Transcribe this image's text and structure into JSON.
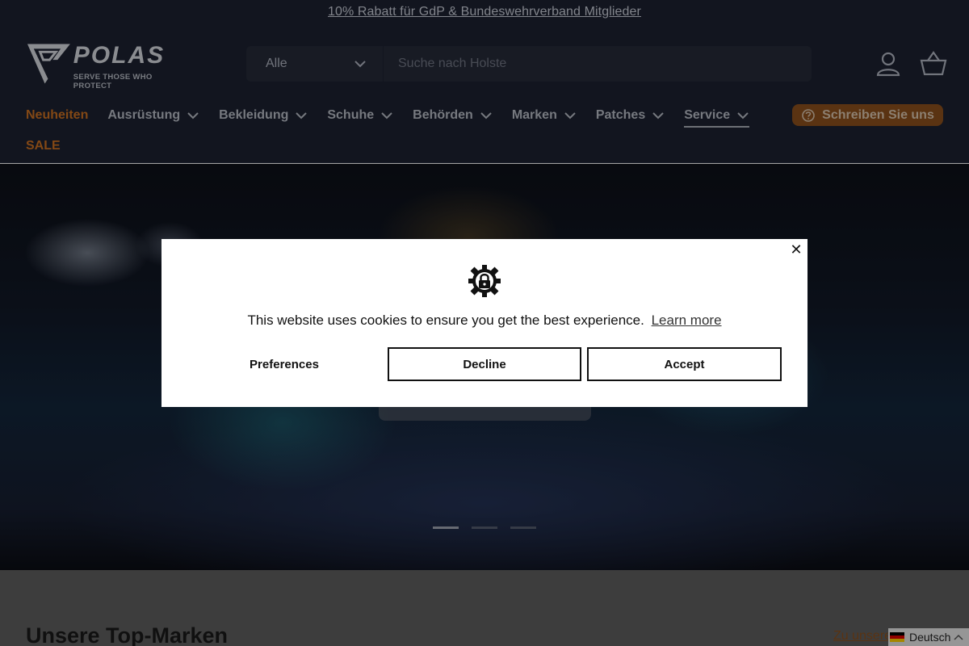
{
  "header": {
    "promo": "10% Rabatt für GdP & Bundeswehrverband Mitglieder",
    "logo": {
      "word": "POLAS",
      "tagline": "SERVE THOSE WHO PROTECT"
    },
    "search": {
      "category": "Alle",
      "placeholder": "Suche nach Holste"
    },
    "icons": [
      "account-icon",
      "basket-icon"
    ],
    "nav": [
      {
        "label": "Neuheiten",
        "dropdown": false,
        "accent": true
      },
      {
        "label": "Ausrüstung",
        "dropdown": true
      },
      {
        "label": "Bekleidung",
        "dropdown": true
      },
      {
        "label": "Schuhe",
        "dropdown": true
      },
      {
        "label": "Behörden",
        "dropdown": true
      },
      {
        "label": "Marken",
        "dropdown": true
      },
      {
        "label": "Patches",
        "dropdown": true
      },
      {
        "label": "Service",
        "dropdown": true,
        "active": true
      }
    ],
    "sale": "SALE",
    "contact_button": "Schreiben Sie uns"
  },
  "hero": {
    "slides": 3,
    "active_slide": 1
  },
  "cookie": {
    "message": "This website uses cookies to ensure you get the best experience.",
    "learn_more": "Learn more",
    "preferences": "Preferences",
    "decline": "Decline",
    "accept": "Accept",
    "close": "✕"
  },
  "section": {
    "title": "Unsere Top-Marken",
    "link": "Zu unsere"
  },
  "language": {
    "label": "Deutsch"
  },
  "colors": {
    "accent": "#c96f21",
    "header_bg": "#1c2130",
    "button_bg": "#8a4f1c"
  }
}
